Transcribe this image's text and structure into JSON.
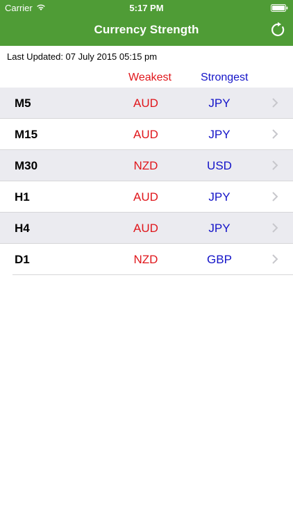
{
  "status_bar": {
    "carrier": "Carrier",
    "time": "5:17 PM"
  },
  "nav": {
    "title": "Currency Strength",
    "refresh_icon": "refresh-icon"
  },
  "last_updated": "Last Updated: 07 July 2015 05:15 pm",
  "columns": {
    "weakest": "Weakest",
    "strongest": "Strongest"
  },
  "rows": [
    {
      "timeframe": "M5",
      "weakest": "AUD",
      "strongest": "JPY"
    },
    {
      "timeframe": "M15",
      "weakest": "AUD",
      "strongest": "JPY"
    },
    {
      "timeframe": "M30",
      "weakest": "NZD",
      "strongest": "USD"
    },
    {
      "timeframe": "H1",
      "weakest": "AUD",
      "strongest": "JPY"
    },
    {
      "timeframe": "H4",
      "weakest": "AUD",
      "strongest": "JPY"
    },
    {
      "timeframe": "D1",
      "weakest": "NZD",
      "strongest": "GBP"
    }
  ],
  "colors": {
    "header": "#4f9c36",
    "weakest": "#e0161b",
    "strongest": "#1313c8",
    "shaded_row": "#ebebf0"
  }
}
